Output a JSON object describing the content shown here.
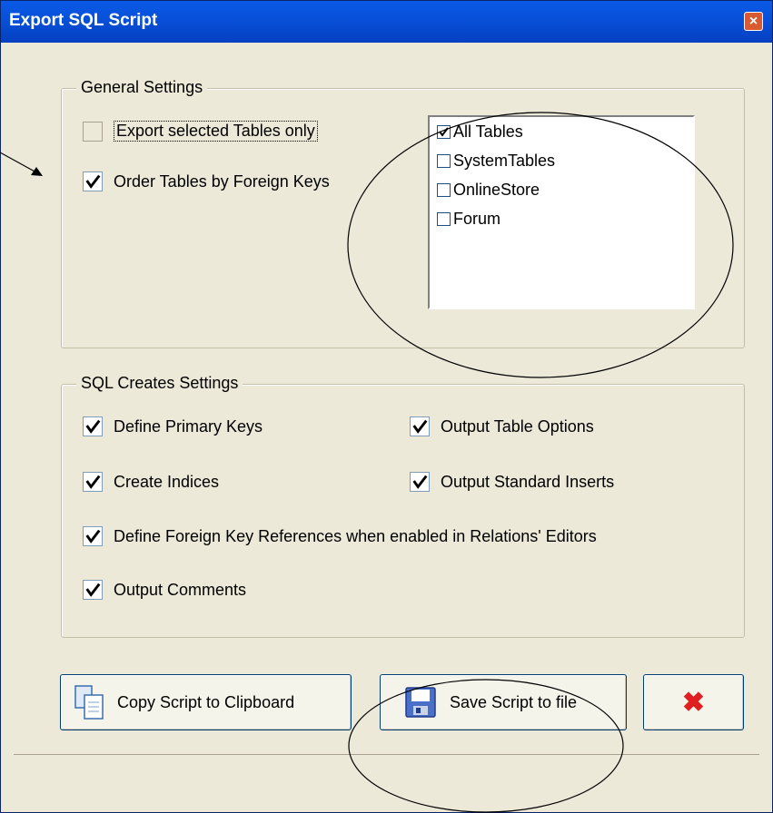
{
  "window": {
    "title": "Export SQL Script",
    "close_icon": "×"
  },
  "general": {
    "label": "General Settings",
    "export_selected_label": "Export selected Tables only",
    "export_selected_checked": false,
    "order_fk_label": "Order Tables by Foreign Keys",
    "order_fk_checked": true,
    "table_list": [
      {
        "label": "All Tables",
        "checked": true
      },
      {
        "label": "SystemTables",
        "checked": false
      },
      {
        "label": "OnlineStore",
        "checked": false
      },
      {
        "label": "Forum",
        "checked": false
      }
    ]
  },
  "creates": {
    "label": "SQL Creates Settings",
    "define_pk": "Define Primary Keys",
    "output_table_options": "Output Table Options",
    "create_indices": "Create Indices",
    "output_standard_inserts": "Output Standard Inserts",
    "define_fk_refs": "Define Foreign Key References when enabled in Relations' Editors",
    "output_comments": "Output Comments"
  },
  "buttons": {
    "copy_label": "Copy Script to Clipboard",
    "save_label": "Save Script to file",
    "cancel_icon": "✖"
  },
  "colors": {
    "title_bar": "#0750d8",
    "dialog_bg": "#ece9d8",
    "cancel_red": "#e02020"
  }
}
